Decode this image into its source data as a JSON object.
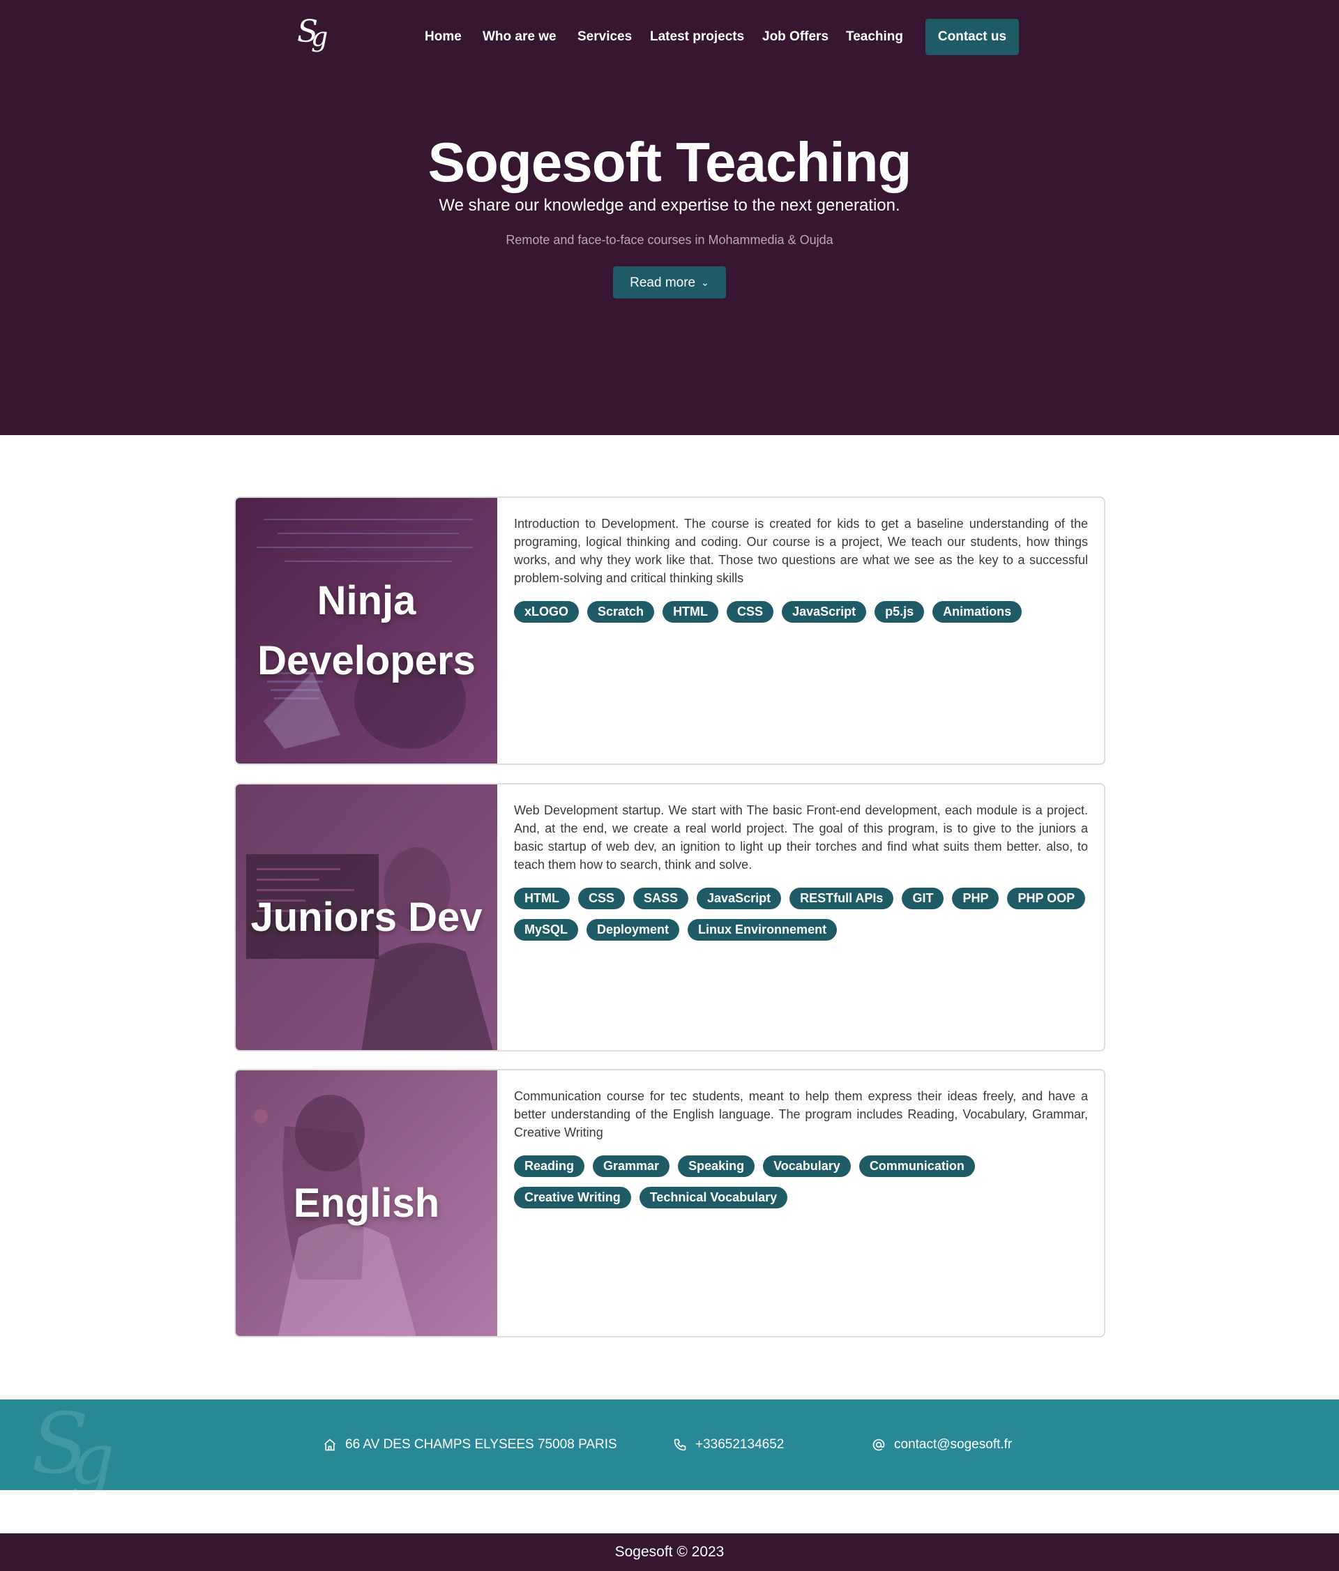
{
  "brand": {
    "logo_text": "Sg",
    "color_dark": "#371632",
    "color_accent": "#1e5b67",
    "color_footer": "#298896"
  },
  "nav": {
    "items": [
      {
        "label": "Home"
      },
      {
        "label": "Who are we"
      },
      {
        "label": "Services"
      },
      {
        "label": "Latest projects"
      },
      {
        "label": "Job Offers"
      },
      {
        "label": "Teaching"
      }
    ],
    "contact_label": "Contact us"
  },
  "hero": {
    "title": "Sogesoft Teaching",
    "subtitle": "We share our knowledge and expertise to the next generation.",
    "note": "Remote and face-to-face courses in Mohammedia & Oujda",
    "read_more_label": "Read more",
    "read_more_icon": "chevron-down-icon"
  },
  "courses": [
    {
      "title": "Ninja Developers",
      "description": "Introduction to Development. The course is created for kids to get a baseline understanding of the programing, logical thinking and coding. Our course is a project, We teach our students, how things works, and why they work like that. Those two questions are what we see as the key to a successful problem-solving and critical thinking skills",
      "tags": [
        "xLOGO",
        "Scratch",
        "HTML",
        "CSS",
        "JavaScript",
        "p5.js",
        "Animations"
      ]
    },
    {
      "title": "Juniors Dev",
      "description": "Web Development startup. We start with The basic Front-end development, each module is a project. And, at the end, we create a real world project. The goal of this program, is to give to the juniors a basic startup of web dev, an ignition to light up their torches and find what suits them better. also, to teach them how to search, think and solve.",
      "tags": [
        "HTML",
        "CSS",
        "SASS",
        "JavaScript",
        "RESTfull APIs",
        "GIT",
        "PHP",
        "PHP OOP",
        "MySQL",
        "Deployment",
        "Linux Environnement"
      ]
    },
    {
      "title": "English",
      "description": "Communication course for tec students, meant to help them express their ideas freely, and have a better understanding of the English language. The program includes Reading, Vocabulary, Grammar, Creative Writing",
      "tags": [
        "Reading",
        "Grammar",
        "Speaking",
        "Vocabulary",
        "Communication",
        "Creative Writing",
        "Technical Vocabulary"
      ]
    }
  ],
  "footer": {
    "address": "66 AV DES CHAMPS ELYSEES 75008 PARIS",
    "address_icon": "home-icon",
    "phone": "+33652134652",
    "phone_icon": "phone-icon",
    "email": "contact@sogesoft.fr",
    "email_icon": "at-icon",
    "copyright": "Sogesoft © 2023"
  }
}
